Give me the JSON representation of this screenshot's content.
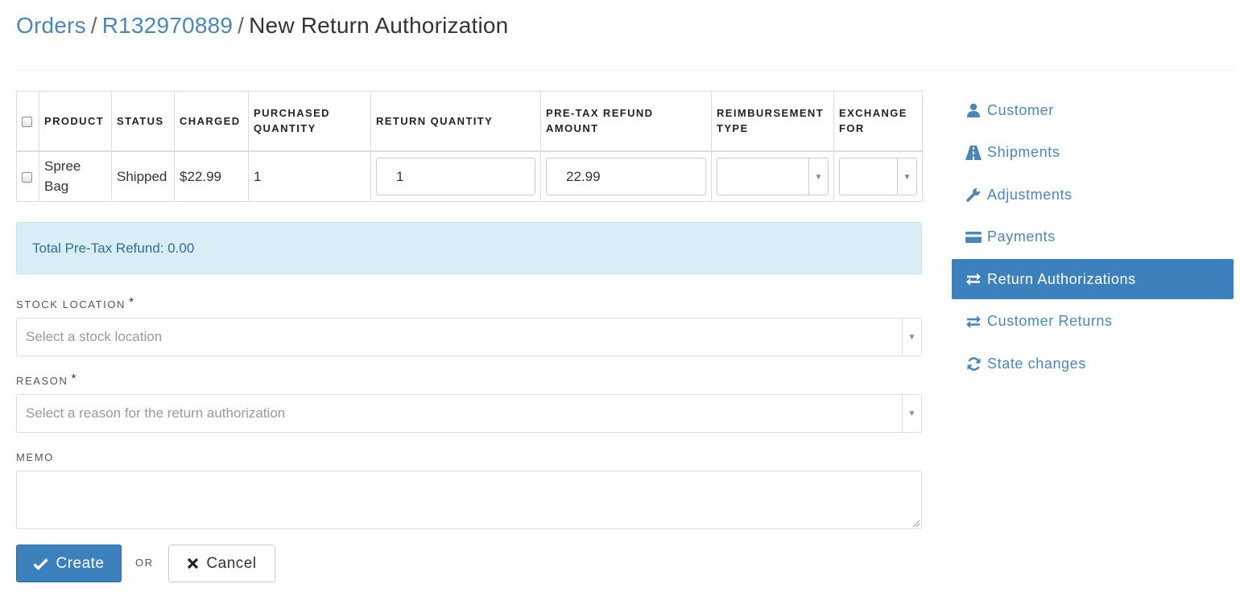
{
  "breadcrumb": {
    "orders": "Orders",
    "order_number": "R132970889",
    "current": "New Return Authorization",
    "separator": "/"
  },
  "table": {
    "headers": {
      "product": "PRODUCT",
      "status": "STATUS",
      "charged": "CHARGED",
      "purchased_quantity": "PURCHASED QUANTITY",
      "return_quantity": "RETURN QUANTITY",
      "pre_tax_refund_amount": "PRE-TAX REFUND AMOUNT",
      "reimbursement_type": "REIMBURSEMENT TYPE",
      "exchange_for": "EXCHANGE FOR"
    },
    "rows": [
      {
        "checked": false,
        "product": "Spree Bag",
        "status": "Shipped",
        "charged": "$22.99",
        "purchased_quantity": "1",
        "return_quantity": "1",
        "pre_tax_refund_amount": "22.99",
        "reimbursement_type": "",
        "exchange_for": ""
      }
    ]
  },
  "total_refund": "Total Pre-Tax Refund: 0.00",
  "form": {
    "stock_location_label": "STOCK LOCATION",
    "stock_location_placeholder": "Select a stock location",
    "reason_label": "REASON",
    "reason_placeholder": "Select a reason for the return authorization",
    "memo_label": "MEMO",
    "memo_value": "",
    "required_mark": "*"
  },
  "actions": {
    "create_label": "Create",
    "or_label": "OR",
    "cancel_label": "Cancel"
  },
  "sidebar": {
    "items": [
      {
        "label": "Customer",
        "icon": "user-icon",
        "active": false
      },
      {
        "label": "Shipments",
        "icon": "road-icon",
        "active": false
      },
      {
        "label": "Adjustments",
        "icon": "wrench-icon",
        "active": false
      },
      {
        "label": "Payments",
        "icon": "credit-card-icon",
        "active": false
      },
      {
        "label": "Return Authorizations",
        "icon": "exchange-icon",
        "active": true
      },
      {
        "label": "Customer Returns",
        "icon": "exchange-icon",
        "active": false
      },
      {
        "label": "State changes",
        "icon": "refresh-icon",
        "active": false
      }
    ]
  },
  "colors": {
    "link": "#4a87b8",
    "primary": "#3c80bc",
    "info_bg": "#d9edf7",
    "info_text": "#31708f"
  }
}
